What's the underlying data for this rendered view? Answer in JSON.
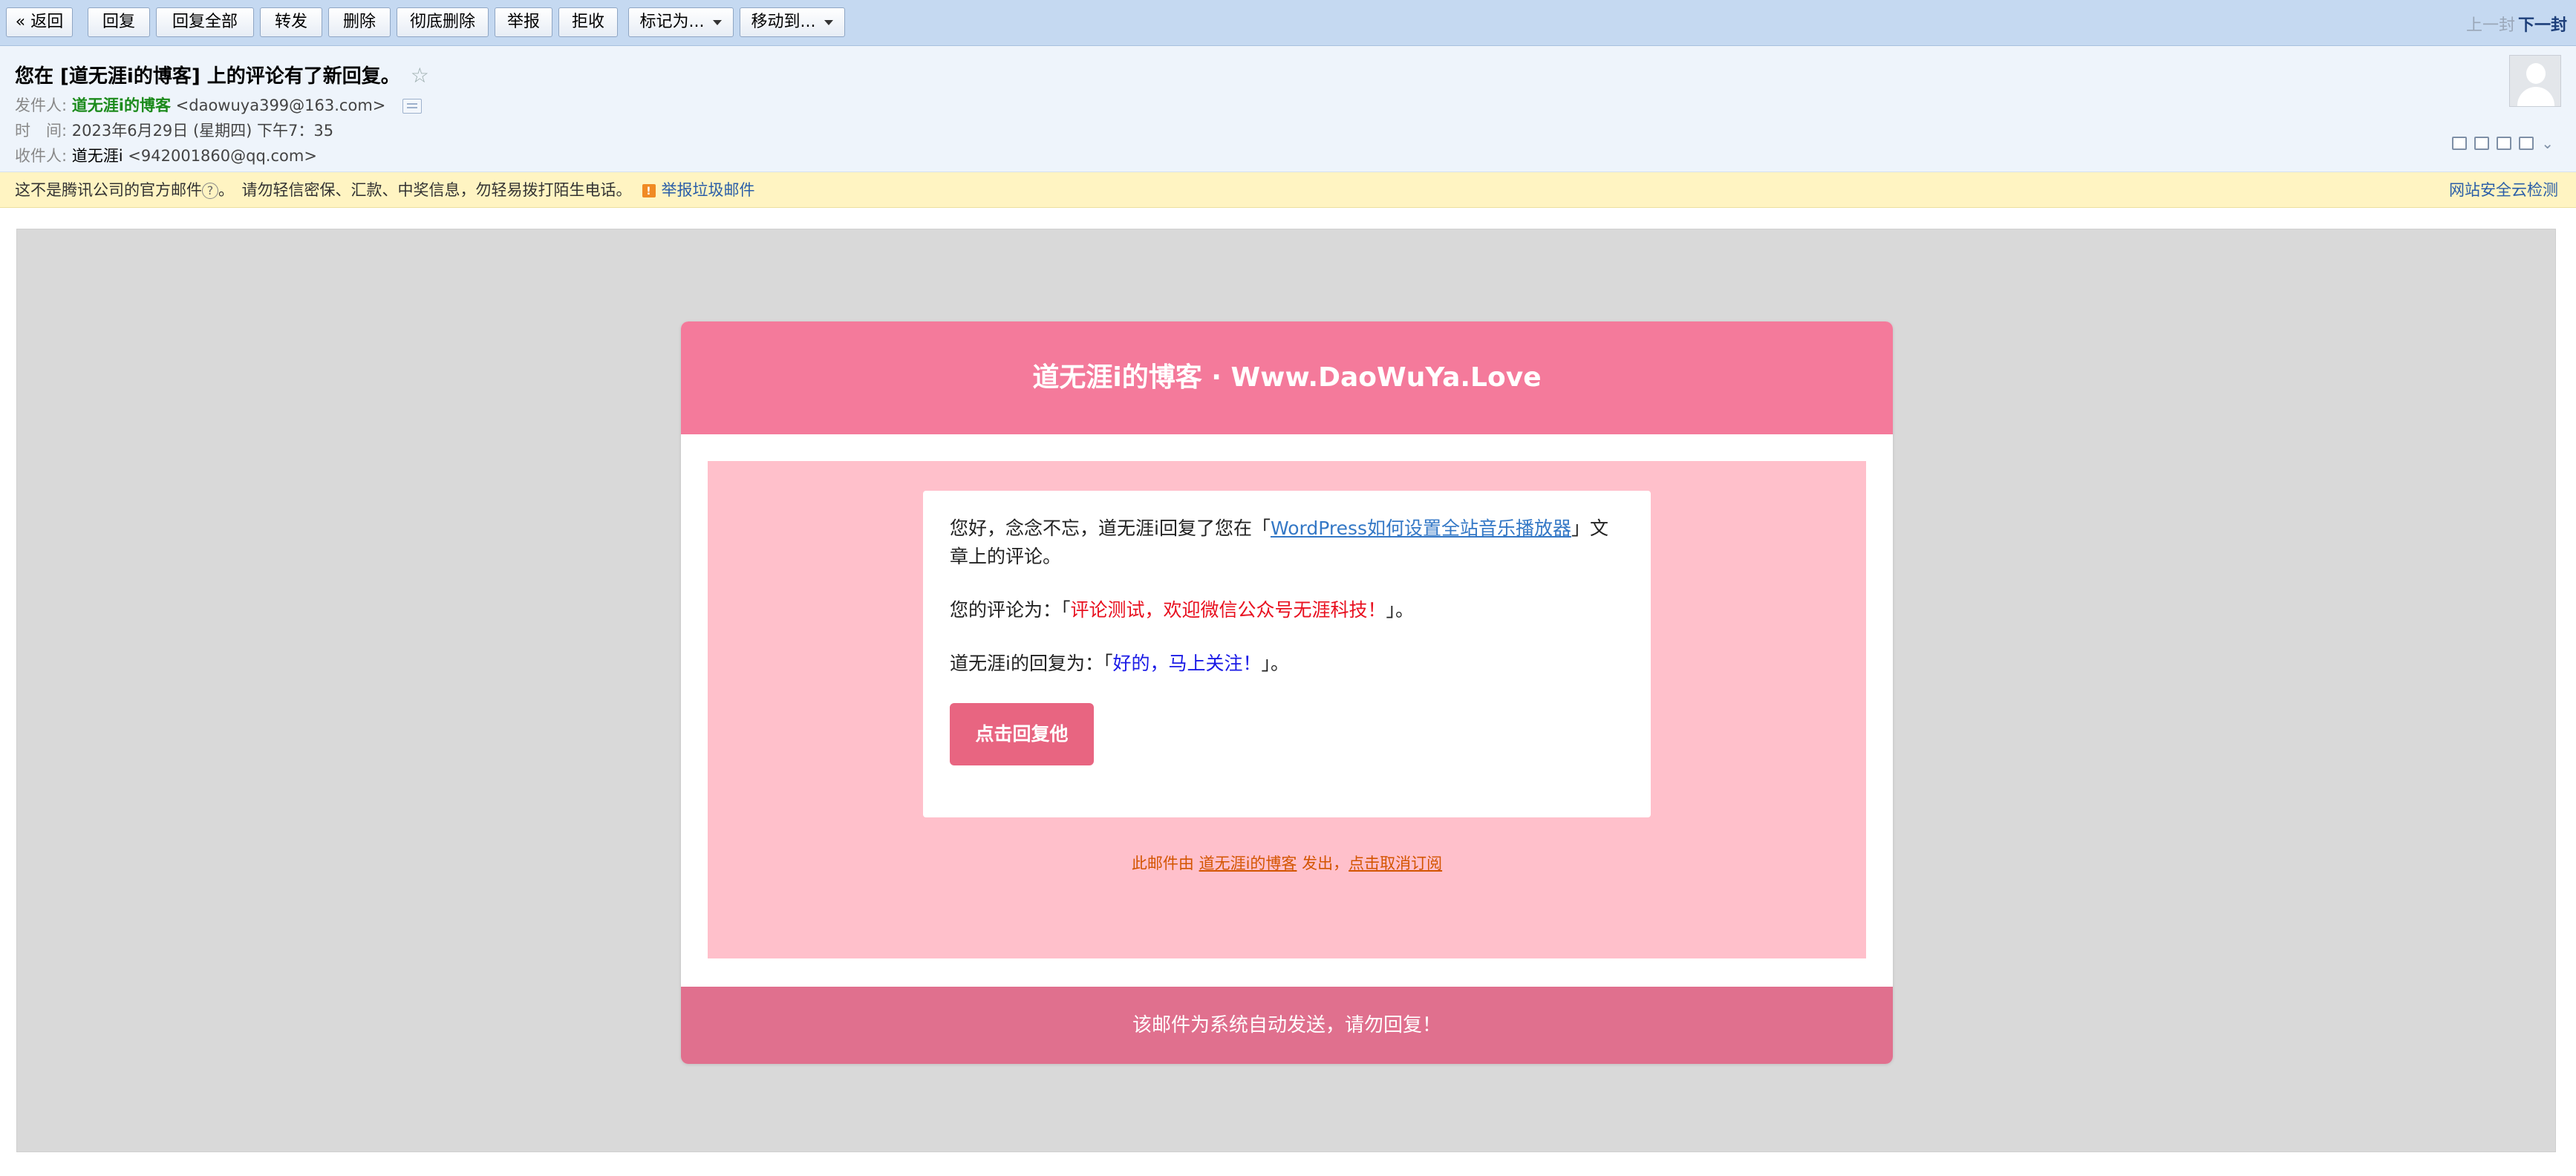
{
  "toolbar": {
    "back": "« 返回",
    "reply": "回复",
    "reply_all": "回复全部",
    "forward": "转发",
    "delete": "删除",
    "delete_permanently": "彻底删除",
    "report": "举报",
    "reject": "拒收",
    "mark_as": "标记为...",
    "move_to": "移动到...",
    "prev_mail": "上一封",
    "next_mail": "下一封"
  },
  "header": {
    "subject": "您在 [道无涯i的博客] 上的评论有了新回复。",
    "star_icon": "☆",
    "from_label": "发件人:",
    "from_name": "道无涯i的博客",
    "from_email": "<daowuya399@163.com>",
    "time_label": "时　间:",
    "time_value": "2023年6月29日 (星期四) 下午7：35",
    "to_label": "收件人:",
    "to_name": "道无涯i",
    "to_email": "<942001860@qq.com>"
  },
  "warning": {
    "text_1": "这不是腾讯公司的官方邮件",
    "q_icon": "?",
    "text_2": "。　请勿轻信密保、汇款、中奖信息，勿轻易拨打陌生电话。",
    "report_spam": "举报垃圾邮件",
    "security_check": "网站安全云检测"
  },
  "email": {
    "header_title": "道无涯i的博客 · Www.DaoWuYa.Love",
    "greeting_before": "您好，念念不忘，道无涯i回复了您在「",
    "article_link": "WordPress如何设置全站音乐播放器",
    "greeting_after": "」文章上的评论。",
    "comment_label": "您的评论为：「",
    "comment_text": "评论测试，欢迎微信公众号无涯科技！",
    "comment_end": "」。",
    "reply_label": "道无涯i的回复为：「",
    "reply_text": "好的，马上关注！",
    "reply_end": "」。",
    "reply_button": "点击回复他",
    "footnote_before": "此邮件由 ",
    "footnote_blog_link": "道无涯i的博客",
    "footnote_middle": " 发出，",
    "footnote_unsubscribe": "点击取消订阅",
    "footer": "该邮件为系统自动发送，请勿回复！"
  },
  "colors": {
    "toolbar_bg": "#c5d9f1",
    "card_header": "#f47a9b",
    "card_footer": "#e0708e",
    "pink_panel": "#ffc0cb",
    "reply_button": "#e86581"
  }
}
